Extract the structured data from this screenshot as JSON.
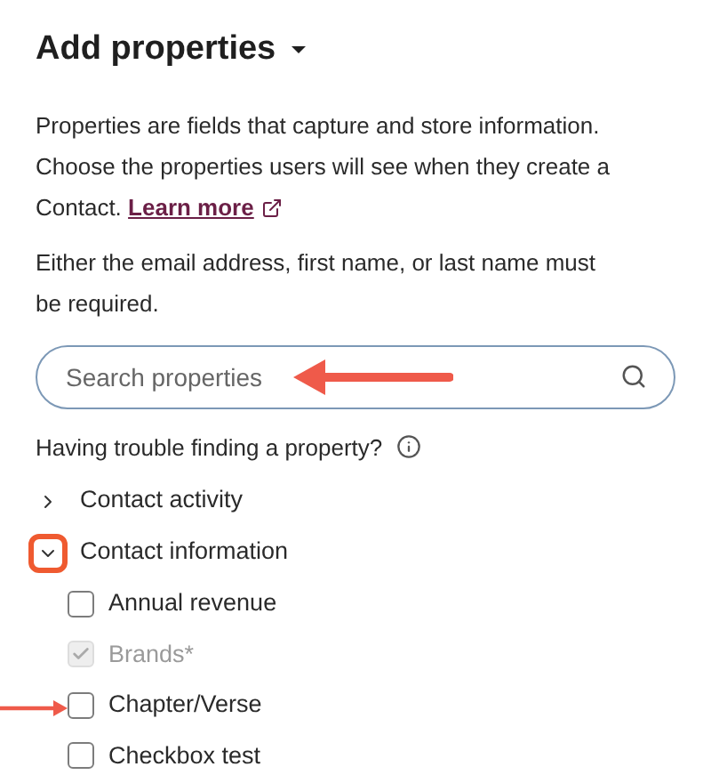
{
  "title": "Add properties",
  "description": {
    "text": "Properties are fields that capture and store information. Choose the properties users will see when they create a Contact.",
    "link": "Learn more"
  },
  "note": "Either the email address, first name, or last name must be required.",
  "search": {
    "placeholder": "Search properties",
    "annotated": true
  },
  "help": "Having trouble finding a property?",
  "groups": [
    {
      "label": "Contact activity",
      "expanded": false,
      "highlighted": false
    },
    {
      "label": "Contact information",
      "expanded": true,
      "highlighted": true,
      "items": [
        {
          "label": "Annual revenue",
          "checked": false,
          "disabled": false,
          "annotated": false
        },
        {
          "label": "Brands*",
          "checked": true,
          "disabled": true,
          "annotated": false
        },
        {
          "label": "Chapter/Verse",
          "checked": false,
          "disabled": false,
          "annotated": true
        },
        {
          "label": "Checkbox test",
          "checked": false,
          "disabled": false,
          "annotated": false
        }
      ]
    }
  ]
}
